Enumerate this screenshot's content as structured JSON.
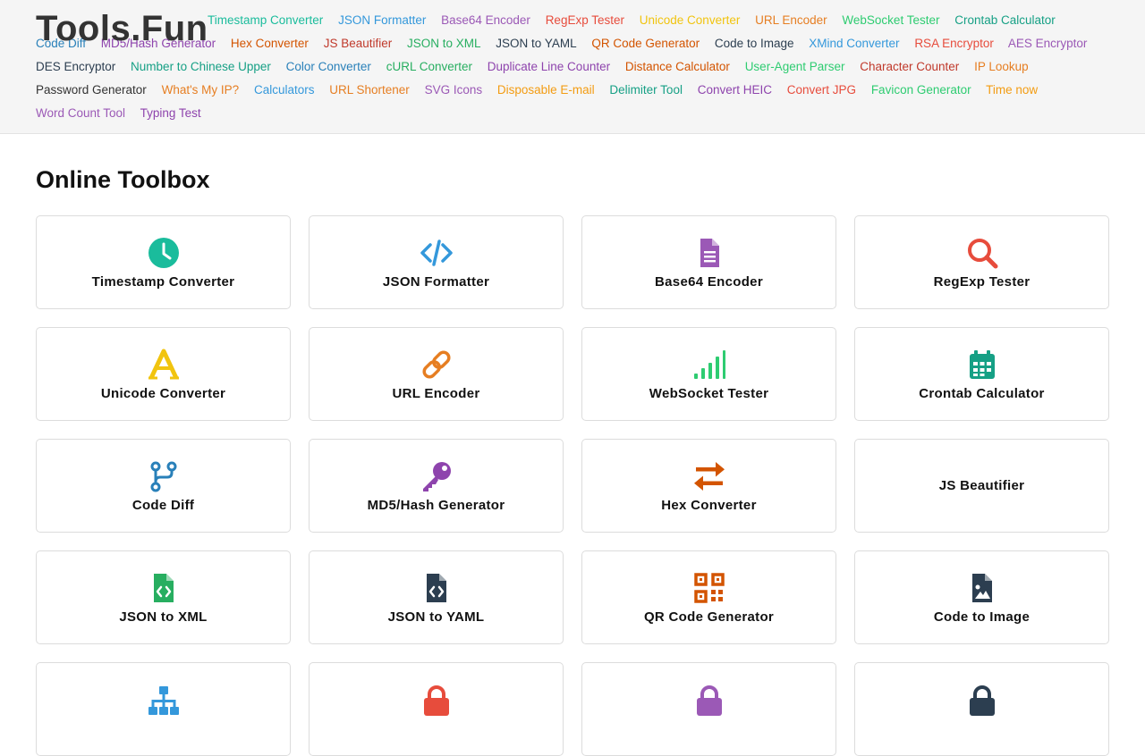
{
  "brand": {
    "name": "Tools.Fun"
  },
  "nav": [
    {
      "label": "Timestamp Converter",
      "color": "#1abc9c"
    },
    {
      "label": "JSON Formatter",
      "color": "#3498db"
    },
    {
      "label": "Base64 Encoder",
      "color": "#9b59b6"
    },
    {
      "label": "RegExp Tester",
      "color": "#e74c3c"
    },
    {
      "label": "Unicode Converter",
      "color": "#f1c40f"
    },
    {
      "label": "URL Encoder",
      "color": "#e67e22"
    },
    {
      "label": "WebSocket Tester",
      "color": "#2ecc71"
    },
    {
      "label": "Crontab Calculator",
      "color": "#16a085"
    },
    {
      "label": "Code Diff",
      "color": "#2980b9"
    },
    {
      "label": "MD5/Hash Generator",
      "color": "#8e44ad"
    },
    {
      "label": "Hex Converter",
      "color": "#d35400"
    },
    {
      "label": "JS Beautifier",
      "color": "#c0392b"
    },
    {
      "label": "JSON to XML",
      "color": "#27ae60"
    },
    {
      "label": "JSON to YAML",
      "color": "#2c3e50"
    },
    {
      "label": "QR Code Generator",
      "color": "#d35400"
    },
    {
      "label": "Code to Image",
      "color": "#2c3e50"
    },
    {
      "label": "XMind Converter",
      "color": "#3498db"
    },
    {
      "label": "RSA Encryptor",
      "color": "#e74c3c"
    },
    {
      "label": "AES Encryptor",
      "color": "#9b59b6"
    },
    {
      "label": "DES Encryptor",
      "color": "#2c3e50"
    },
    {
      "label": "Number to Chinese Upper",
      "color": "#16a085"
    },
    {
      "label": "Color Converter",
      "color": "#2980b9"
    },
    {
      "label": "cURL Converter",
      "color": "#27ae60"
    },
    {
      "label": "Duplicate Line Counter",
      "color": "#8e44ad"
    },
    {
      "label": "Distance Calculator",
      "color": "#d35400"
    },
    {
      "label": "User-Agent Parser",
      "color": "#2ecc71"
    },
    {
      "label": "Character Counter",
      "color": "#c0392b"
    },
    {
      "label": "IP Lookup",
      "color": "#e67e22"
    },
    {
      "label": "Password Generator",
      "color": "#333333"
    },
    {
      "label": "What's My IP?",
      "color": "#e67e22"
    },
    {
      "label": "Calculators",
      "color": "#3498db"
    },
    {
      "label": "URL Shortener",
      "color": "#e67e22"
    },
    {
      "label": "SVG Icons",
      "color": "#9b59b6"
    },
    {
      "label": "Disposable E-mail",
      "color": "#f39c12"
    },
    {
      "label": "Delimiter Tool",
      "color": "#16a085"
    },
    {
      "label": "Convert HEIC",
      "color": "#8e44ad"
    },
    {
      "label": "Convert JPG",
      "color": "#e74c3c"
    },
    {
      "label": "Favicon Generator",
      "color": "#2ecc71"
    },
    {
      "label": "Time now",
      "color": "#f39c12"
    },
    {
      "label": "Word Count Tool",
      "color": "#9b59b6"
    },
    {
      "label": "Typing Test",
      "color": "#8e44ad"
    }
  ],
  "main": {
    "title": "Online Toolbox",
    "tools": [
      {
        "label": "Timestamp Converter",
        "icon": "clock-icon",
        "color": "#1abc9c"
      },
      {
        "label": "JSON Formatter",
        "icon": "code-icon",
        "color": "#3498db"
      },
      {
        "label": "Base64 Encoder",
        "icon": "file-text-icon",
        "color": "#9b59b6"
      },
      {
        "label": "RegExp Tester",
        "icon": "search-icon",
        "color": "#e74c3c"
      },
      {
        "label": "Unicode Converter",
        "icon": "font-icon",
        "color": "#f1c40f"
      },
      {
        "label": "URL Encoder",
        "icon": "link-icon",
        "color": "#e67e22"
      },
      {
        "label": "WebSocket Tester",
        "icon": "signal-icon",
        "color": "#2ecc71"
      },
      {
        "label": "Crontab Calculator",
        "icon": "calendar-icon",
        "color": "#16a085"
      },
      {
        "label": "Code Diff",
        "icon": "code-branch-icon",
        "color": "#2980b9"
      },
      {
        "label": "MD5/Hash Generator",
        "icon": "key-icon",
        "color": "#8e44ad"
      },
      {
        "label": "Hex Converter",
        "icon": "exchange-icon",
        "color": "#d35400"
      },
      {
        "label": "JS Beautifier",
        "icon": "",
        "color": ""
      },
      {
        "label": "JSON to XML",
        "icon": "file-code-icon",
        "color": "#27ae60"
      },
      {
        "label": "JSON to YAML",
        "icon": "file-code-icon",
        "color": "#2c3e50"
      },
      {
        "label": "QR Code Generator",
        "icon": "qrcode-icon",
        "color": "#d35400"
      },
      {
        "label": "Code to Image",
        "icon": "file-image-icon",
        "color": "#2c3e50"
      },
      {
        "label": "",
        "icon": "sitemap-icon",
        "color": "#3498db"
      },
      {
        "label": "",
        "icon": "lock-icon",
        "color": "#e74c3c"
      },
      {
        "label": "",
        "icon": "lock-icon",
        "color": "#9b59b6"
      },
      {
        "label": "",
        "icon": "lock-icon",
        "color": "#2c3e50"
      }
    ]
  }
}
